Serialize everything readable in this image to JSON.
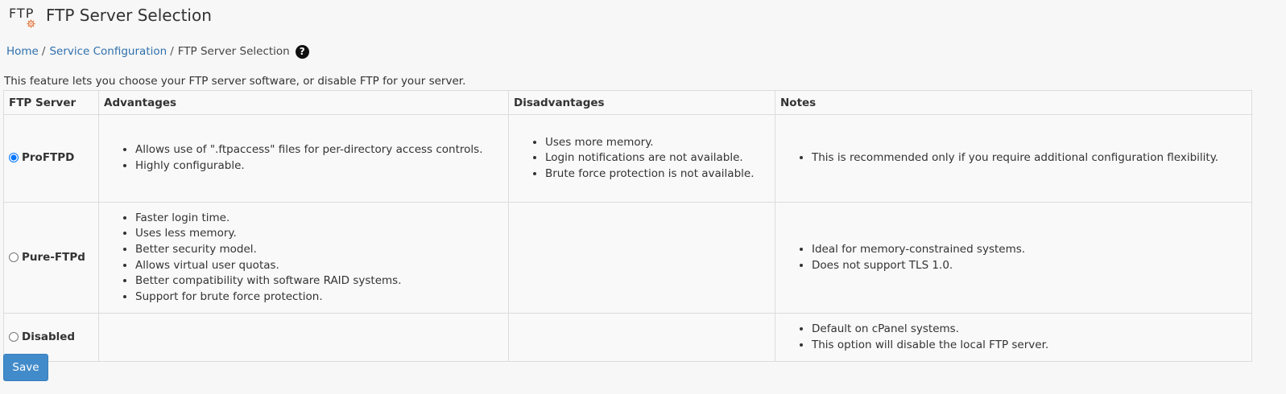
{
  "header": {
    "logo_text": "FTP",
    "title": "FTP Server Selection"
  },
  "breadcrumb": {
    "home": "Home",
    "section": "Service Configuration",
    "current": "FTP Server Selection",
    "help_icon": "question-circle-icon"
  },
  "intro": "This feature lets you choose your FTP server software, or disable FTP for your server.",
  "table": {
    "headers": [
      "FTP Server",
      "Advantages",
      "Disadvantages",
      "Notes"
    ],
    "rows": [
      {
        "server": "ProFTPD",
        "selected": true,
        "advantages": [
          "Allows use of \".ftpaccess\" files for per-directory access controls.",
          "Highly configurable."
        ],
        "disadvantages": [
          "Uses more memory.",
          "Login notifications are not available.",
          "Brute force protection is not available."
        ],
        "notes": [
          "This is recommended only if you require additional configuration flexibility."
        ]
      },
      {
        "server": "Pure-FTPd",
        "selected": false,
        "advantages": [
          "Faster login time.",
          "Uses less memory.",
          "Better security model.",
          "Allows virtual user quotas.",
          "Better compatibility with software RAID systems.",
          "Support for brute force protection."
        ],
        "disadvantages": [],
        "notes": [
          "Ideal for memory-constrained systems.",
          "Does not support TLS 1.0."
        ]
      },
      {
        "server": "Disabled",
        "selected": false,
        "advantages": [],
        "disadvantages": [],
        "notes": [
          "Default on cPanel systems.",
          "This option will disable the local FTP server."
        ]
      }
    ]
  },
  "save_label": "Save",
  "colors": {
    "link": "#2f6fad",
    "save_button": "#428bca",
    "logo_accent": "#e8743b"
  }
}
